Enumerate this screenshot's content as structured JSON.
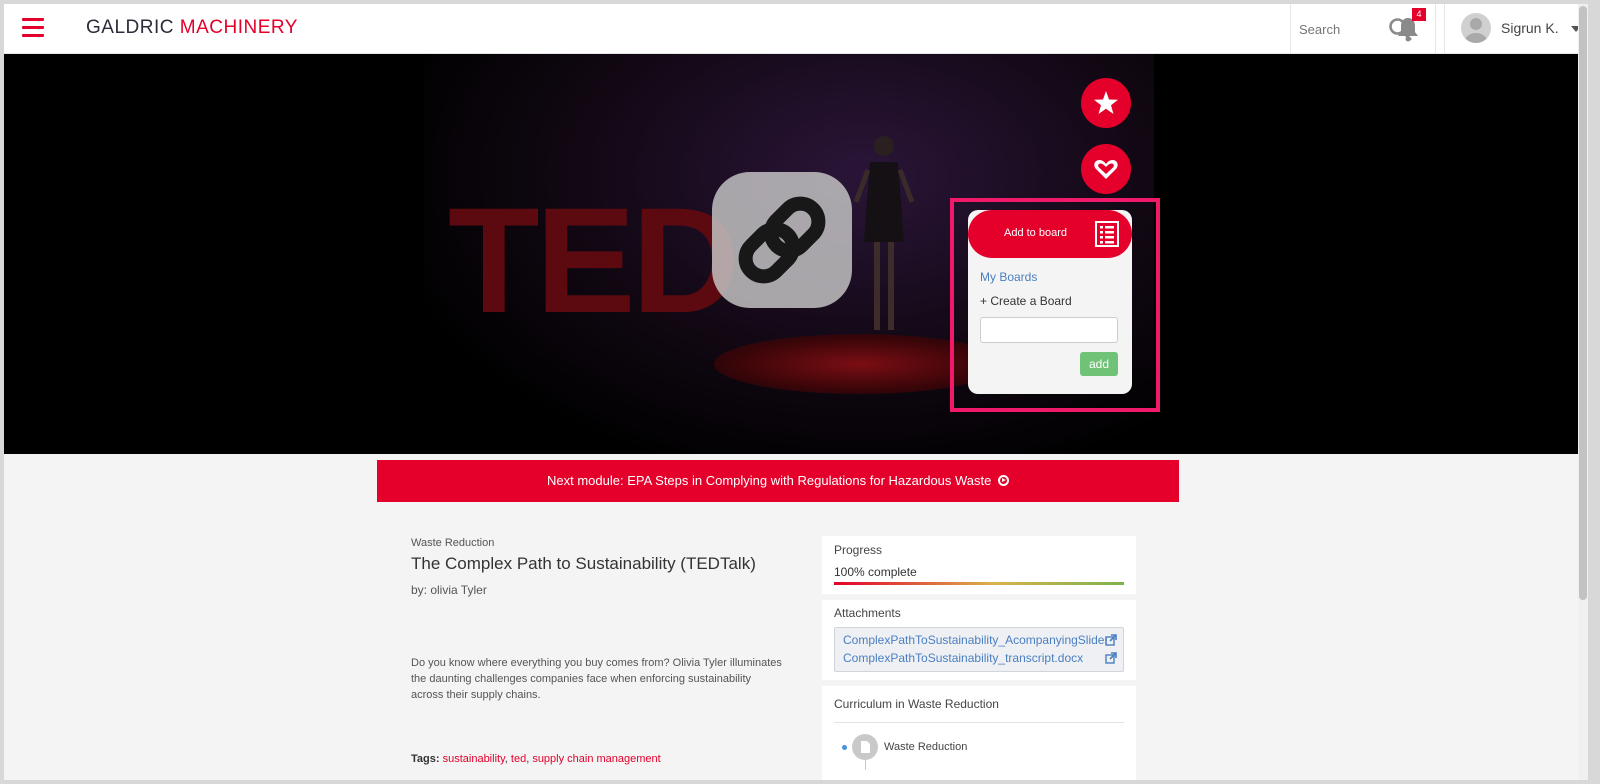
{
  "header": {
    "logo_part1": "GALDRIC",
    "logo_part2": "MACHINERY",
    "search_placeholder": "Search",
    "notification_count": "4",
    "user_name": "Sigrun K."
  },
  "hero": {
    "add_to_board": {
      "header_label": "Add to board",
      "my_boards": "My Boards",
      "create_board": "+ Create a Board",
      "input_value": "",
      "add_button": "add"
    }
  },
  "next_module": {
    "label": "Next module: EPA Steps in Complying with Regulations for Hazardous Waste"
  },
  "content": {
    "category": "Waste Reduction",
    "title": "The Complex Path to Sustainability (TEDTalk)",
    "author": "by: olivia Tyler",
    "description": "Do you know where everything you buy comes from? Olivia Tyler illuminates the daunting challenges companies face when enforcing sustainability across their supply chains.",
    "tags_label": "Tags:",
    "tags": [
      "sustainability",
      "ted",
      "supply chain management"
    ]
  },
  "progress": {
    "title": "Progress",
    "text": "100% complete",
    "percent": 100
  },
  "attachments": {
    "title": "Attachments",
    "files": [
      "ComplexPathToSustainability_AcompanyingSlides.pptx",
      "ComplexPathToSustainability_transcript.docx"
    ]
  },
  "curriculum": {
    "title": "Curriculum in Waste Reduction",
    "items": [
      "Waste Reduction"
    ]
  },
  "colors": {
    "brand_red": "#e4002b",
    "highlight_pink": "#f0196a",
    "link_blue": "#4a7fc1",
    "add_green": "#6fc276"
  }
}
